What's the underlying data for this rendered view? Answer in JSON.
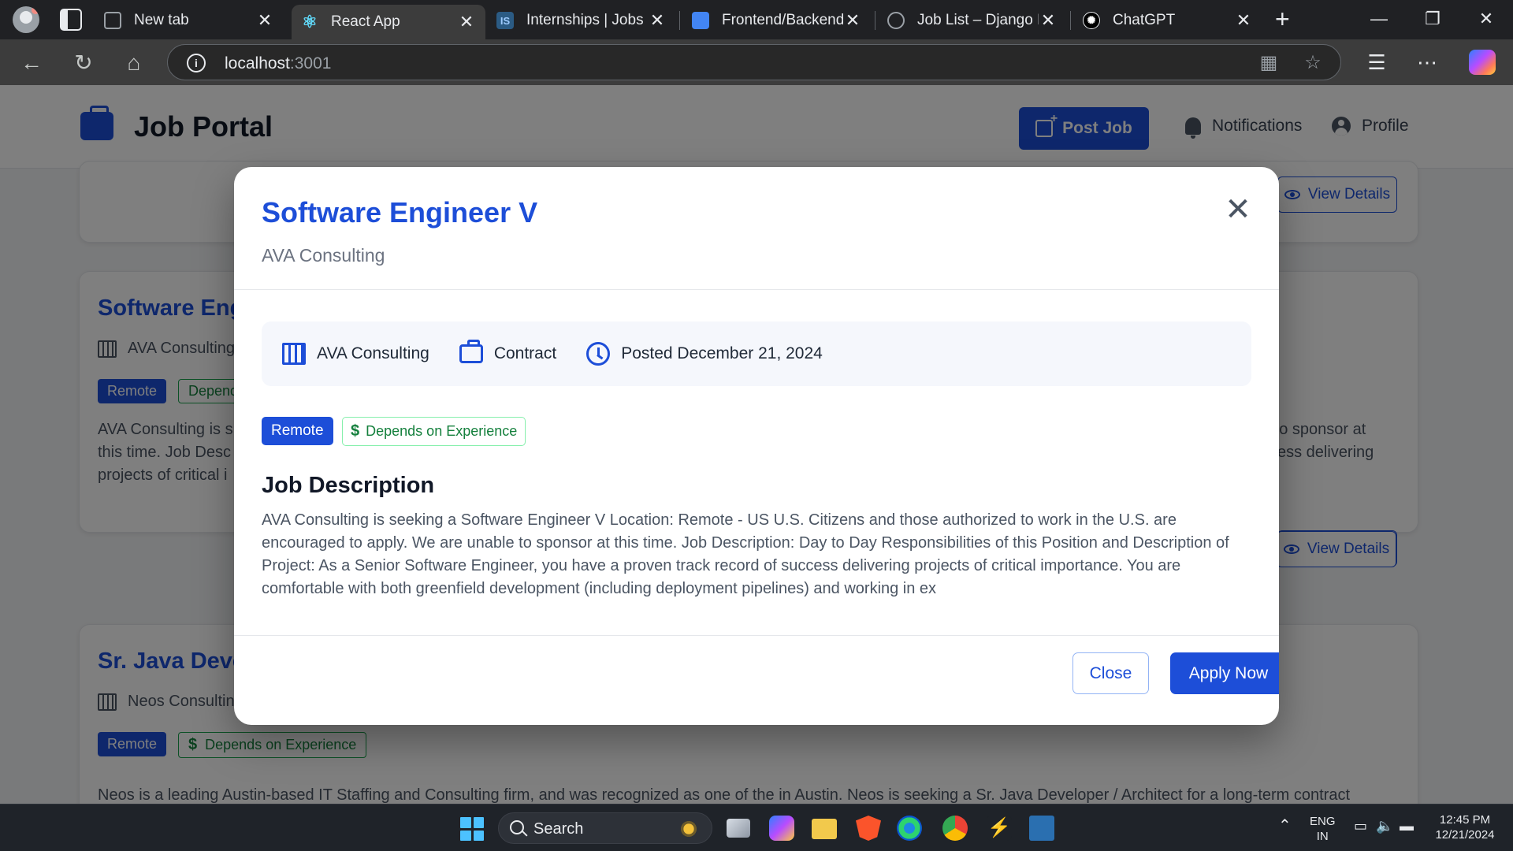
{
  "browser": {
    "tabs": [
      {
        "title": "New tab",
        "icon": "newtab-icon"
      },
      {
        "title": "React App",
        "icon": "react-icon",
        "active": true
      },
      {
        "title": "Internships | Jobs | T",
        "icon": "is-icon"
      },
      {
        "title": "Frontend/Backend A",
        "icon": "docs-icon"
      },
      {
        "title": "Job List – Django RE",
        "icon": "globe-icon"
      },
      {
        "title": "ChatGPT",
        "icon": "chatgpt-icon"
      }
    ],
    "url_host": "localhost",
    "url_port": ":3001"
  },
  "header": {
    "app_title": "Job Portal",
    "post_job_label": "Post Job",
    "notifications_label": "Notifications",
    "profile_label": "Profile"
  },
  "background": {
    "view_details_label": "View Details",
    "cards": [
      {
        "title": "Software Engineer V",
        "company": "AVA Consulting",
        "remote": "Remote",
        "pay": "Depends on Experience",
        "desc_left_1": "AVA Consulting is s",
        "desc_left_2": "this time. Job Desc",
        "desc_left_3": "projects of critical i",
        "desc_right_1": "e to sponsor at",
        "desc_right_2": "ccess delivering"
      },
      {
        "title": "Sr. Java Developer / Architect",
        "company": "Neos Consulting",
        "remote": "Remote",
        "pay": "Depends on Experience",
        "desc": "Neos is a leading Austin-based IT Staffing and Consulting firm, and was recognized as one of the in Austin. Neos is seeking a Sr. Java Developer / Architect for a long-term contract"
      }
    ]
  },
  "modal": {
    "title": "Software Engineer V",
    "company": "AVA Consulting",
    "meta_company": "AVA Consulting",
    "meta_type": "Contract",
    "meta_posted": "Posted December 21, 2024",
    "badge_remote": "Remote",
    "badge_pay": "Depends on Experience",
    "section_heading": "Job Description",
    "description": "AVA Consulting is seeking a Software Engineer V Location: Remote - US U.S. Citizens and those authorized to work in the U.S. are encouraged to apply. We are unable to sponsor at this time. Job Description: Day to Day Responsibilities of this Position and Description of Project: As a Senior Software Engineer, you have a proven track record of success delivering projects of critical importance. You are comfortable with both greenfield development (including deployment pipelines) and working in ex",
    "close_label": "Close",
    "apply_label": "Apply Now"
  },
  "taskbar": {
    "search_label": "Search",
    "lang_1": "ENG",
    "lang_2": "IN",
    "time": "12:45 PM",
    "date": "12/21/2024"
  },
  "colors": {
    "accent": "#1d4ed8",
    "pay_green": "#15803d",
    "overlay": "rgba(0,0,0,0.5)"
  }
}
